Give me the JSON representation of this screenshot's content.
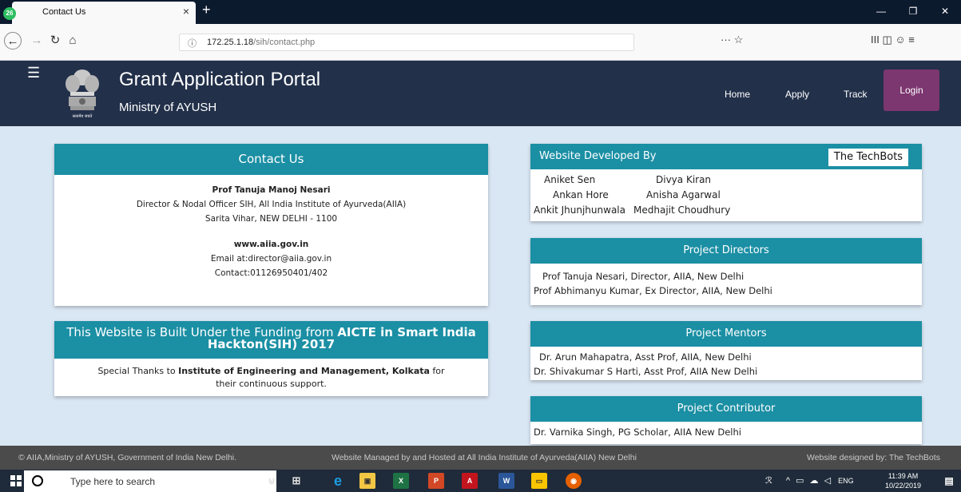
{
  "browser": {
    "tab_title": "Contact Us",
    "tab_badge": "26",
    "tab_close": "×",
    "new_tab": "+",
    "url_host": "172.25.1.18",
    "url_path": "/sih/contact.php",
    "url_icon": "ⓘ",
    "page_actions": "··· ☆",
    "toolbar_icons": "III  ◫  ☺  ≡"
  },
  "site": {
    "title": "Grant Application Portal",
    "subtitle": "Ministry of AYUSH",
    "emblem_caption": "सत्यमेव जयते",
    "nav": {
      "home": "Home",
      "apply": "Apply",
      "track": "Track",
      "login": "Login"
    },
    "colors": {
      "header": "#22304a",
      "card_head": "#1b8fa4",
      "login": "#7c3670"
    }
  },
  "contact": {
    "title": "Contact Us",
    "name": "Prof Tanuja Manoj Nesari",
    "role": "Director & Nodal Officer SIH, All India Institute of Ayurveda(AIIA)",
    "address": "Sarita Vihar, NEW DELHI - 1100",
    "website": "www.aiia.gov.in",
    "email": "Email at:director@aiia.gov.in",
    "phone": "Contact:01126950401/402"
  },
  "funding": {
    "title_plain": "This Website is Built Under the Funding from ",
    "title_bold": "AICTE in Smart India Hackton(SIH) 2017",
    "thanks_prefix": "Special Thanks to ",
    "thanks_bold": "Institute of Engineering and Management, Kolkata",
    "thanks_suffix": " for their continuous support."
  },
  "developers": {
    "title": "Website Developed By",
    "team": "The TechBots",
    "names": [
      "Aniket Sen",
      "Divya Kiran",
      "Ankan Hore",
      "Anisha Agarwal",
      "Ankit Jhunjhunwala",
      "Medhajit Choudhury"
    ]
  },
  "directors": {
    "title": "Project Directors",
    "lines": [
      "Prof Tanuja Nesari, Director, AIIA, New Delhi",
      "Prof Abhimanyu Kumar, Ex Director, AIIA, New Delhi"
    ]
  },
  "mentors": {
    "title": "Project Mentors",
    "lines": [
      "Dr. Arun Mahapatra, Asst Prof, AIIA, New Delhi",
      "Dr. Shivakumar S Harti, Asst Prof, AIIA New Delhi"
    ]
  },
  "contributor": {
    "title": "Project Contributor",
    "lines": [
      "Dr. Varnika Singh, PG Scholar, AIIA New Delhi"
    ]
  },
  "footer": {
    "left": "© AIIA,Ministry of AYUSH, Government of India New Delhi.",
    "center": "Website Managed by and Hosted at All India Institute of Ayurveda(AIIA) New Delhi",
    "right": "Website designed by: The TechBots"
  },
  "taskbar": {
    "search_placeholder": "Type here to search",
    "tray": "ENG",
    "time": "11:39 AM",
    "date": "10/22/2019"
  }
}
